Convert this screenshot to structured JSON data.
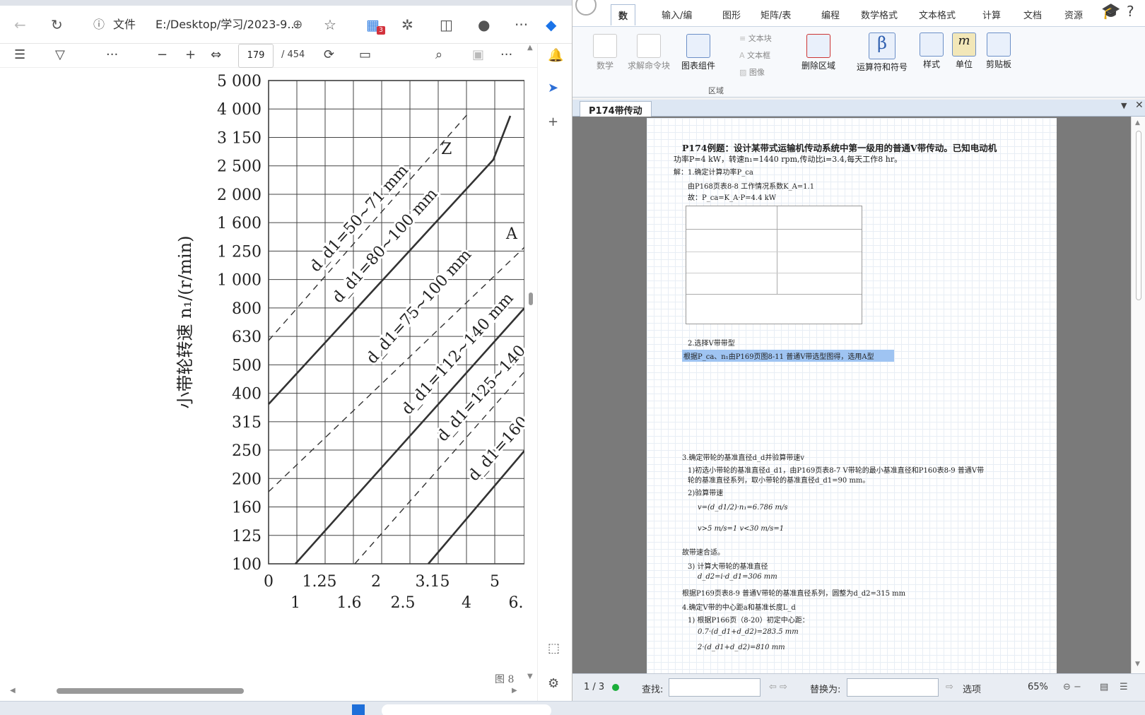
{
  "browser": {
    "file_label": "文件",
    "address": "E:/Desktop/学习/2023-9...",
    "ext_badge": "3"
  },
  "pdf_toolbar": {
    "page_current": "179",
    "page_total": "/ 454"
  },
  "chart_data": {
    "type": "line",
    "ylabel": "小带轮转速 n₁/(r/min)",
    "y_ticks": [
      "100",
      "125",
      "160",
      "200",
      "250",
      "315",
      "400",
      "500",
      "630",
      "800",
      "1 000",
      "1 250",
      "1 600",
      "2 000",
      "2 500",
      "3 150",
      "4 000",
      "5 000"
    ],
    "x_ticks_top": [
      "0",
      "1.25",
      "2",
      "3.15",
      "5"
    ],
    "x_ticks_bottom": [
      "1",
      "1.6",
      "2.5",
      "4",
      "6."
    ],
    "region_labels": [
      "Z",
      "A"
    ],
    "line_labels": [
      "d_d1=50~71 mm",
      "d_d1=80~100 mm",
      "d_d1=75~100 mm",
      "d_d1=112~140 mm",
      "d_d1=125~140",
      "d_d1=160~"
    ],
    "footer_fragment": "图 8"
  },
  "editor": {
    "ribbon_tabs": [
      "数",
      "输入/编",
      "图形",
      "矩阵/表",
      "编程",
      "数学格式",
      "文本格式",
      "计算",
      "文档",
      "资源"
    ],
    "ribbon_buttons": {
      "math": "数学",
      "solve": "求解命令块",
      "chart": "图表组件",
      "textblock": "文本块",
      "textbox": "文本框",
      "image": "图像",
      "delete_region": "删除区域",
      "operators": "运算符和符号",
      "style": "样式",
      "unit": "单位",
      "clipboard": "剪贴板",
      "group": "区域"
    },
    "doc_tab": "P174带传动",
    "content": {
      "heading": "P174例题：设计某带式运输机传动系统中第一级用的普通V带传动。已知电动机",
      "line2": "功率P=4 kW，转速n₁=1440 rpm,传动比i=3.4,每天工作8 hr。",
      "solve": "解：1.确定计算功率P_ca",
      "s1": "由P168页表8-8 工作情况系数K_A=1.1",
      "s2": "故：P_ca=K_A·P=4.4 kW",
      "s3": "2.选择V带带型",
      "s4": "根据P_ca、n₁由P169页图8-11 普通V带选型图得，选用A型",
      "s5": "3.确定带轮的基准直径d_d并验算带速v",
      "s6": "1)初选小带轮的基准直径d_d1，由P169页表8-7 V带轮的最小基准直径和P160表8-9 普通V带",
      "s7": "轮的基准直径系列，取小带轮的基准直径d_d1=90 mm。",
      "s8": "2)验算带速",
      "s9": "v=(d_d1/2)·n₁=6.786 m/s",
      "s10": "v>5 m/s=1    v<30 m/s=1",
      "s11": "故带速合适。",
      "s12": "3) 计算大带轮的基准直径",
      "s13": "d_d2=i·d_d1=306 mm",
      "s14": "根据P169页表8-9 普通V带轮的基准直径系列，圆整为d_d2=315 mm",
      "s15": "4.确定V带的中心距a和基准长度L_d",
      "s16": "1) 根据P166页（8-20）初定中心距：",
      "s17": "0.7·(d_d1+d_d2)=283.5 mm",
      "s18": "2·(d_d1+d_d2)=810 mm"
    },
    "status": {
      "page": "1 / 3",
      "find": "查找:",
      "replace": "替换为:",
      "options": "选项",
      "zoom": "65%"
    }
  }
}
